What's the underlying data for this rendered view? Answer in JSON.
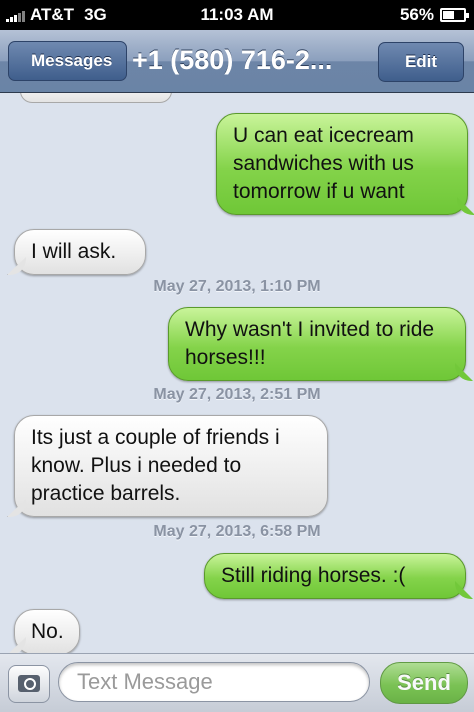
{
  "status_bar": {
    "carrier": "AT&T",
    "network": "3G",
    "time": "11:03 AM",
    "battery_percent_label": "56%",
    "battery_level": 0.56
  },
  "nav": {
    "back_label": "Messages",
    "title": "+1 (580) 716-2...",
    "edit_label": "Edit"
  },
  "messages": [
    {
      "direction": "outgoing",
      "text": "U can eat icecream sandwiches with us tomorrow  if u want"
    },
    {
      "direction": "incoming",
      "text": "I will ask."
    },
    {
      "direction": "timestamp",
      "text": "May 27, 2013, 1:10 PM"
    },
    {
      "direction": "outgoing",
      "text": "Why wasn't  I invited  to ride horses!!!"
    },
    {
      "direction": "timestamp",
      "text": "May 27, 2013, 2:51 PM"
    },
    {
      "direction": "incoming",
      "text": "Its just a couple of friends i know. Plus i needed to practice barrels."
    },
    {
      "direction": "timestamp",
      "text": "May 27, 2013, 6:58 PM"
    },
    {
      "direction": "outgoing",
      "text": "Still riding horses.    :("
    },
    {
      "direction": "incoming",
      "text": "No."
    }
  ],
  "input_bar": {
    "placeholder": "Text Message",
    "value": "",
    "send_label": "Send"
  },
  "icons": [
    "signal-icon",
    "battery-icon",
    "camera-icon"
  ]
}
